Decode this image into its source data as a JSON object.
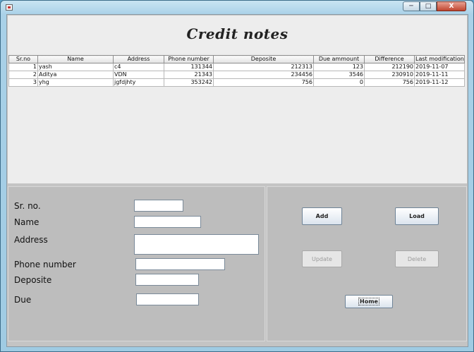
{
  "window": {
    "controls": {
      "minimize": "─",
      "maximize": "□",
      "close": "X"
    }
  },
  "header": {
    "title": "Credit notes"
  },
  "table": {
    "columns": [
      "Sr.no",
      "Name",
      "Address",
      "Phone number",
      "Deposite",
      "Due ammount",
      "Difference",
      "Last modification"
    ],
    "rows": [
      [
        "1",
        "yash",
        "c4",
        "131344",
        "212313",
        "123",
        "212190",
        "2019-11-07"
      ],
      [
        "2",
        "Aditya",
        "VDN",
        "21343",
        "234456",
        "3546",
        "230910",
        "2019-11-11"
      ],
      [
        "3",
        "yhg",
        "jgfdjhty",
        "353242",
        "756",
        "0",
        "756",
        "2019-11-12"
      ]
    ]
  },
  "form": {
    "srno_label": "Sr. no.",
    "name_label": "Name",
    "address_label": "Address",
    "phone_label": "Phone number",
    "deposite_label": "Deposite",
    "due_label": "Due",
    "srno_value": "",
    "name_value": "",
    "address_value": "",
    "phone_value": "",
    "deposite_value": "",
    "due_value": ""
  },
  "buttons": {
    "add": "Add",
    "load": "Load",
    "update": "Update",
    "delete": "Delete",
    "home": "Home"
  }
}
